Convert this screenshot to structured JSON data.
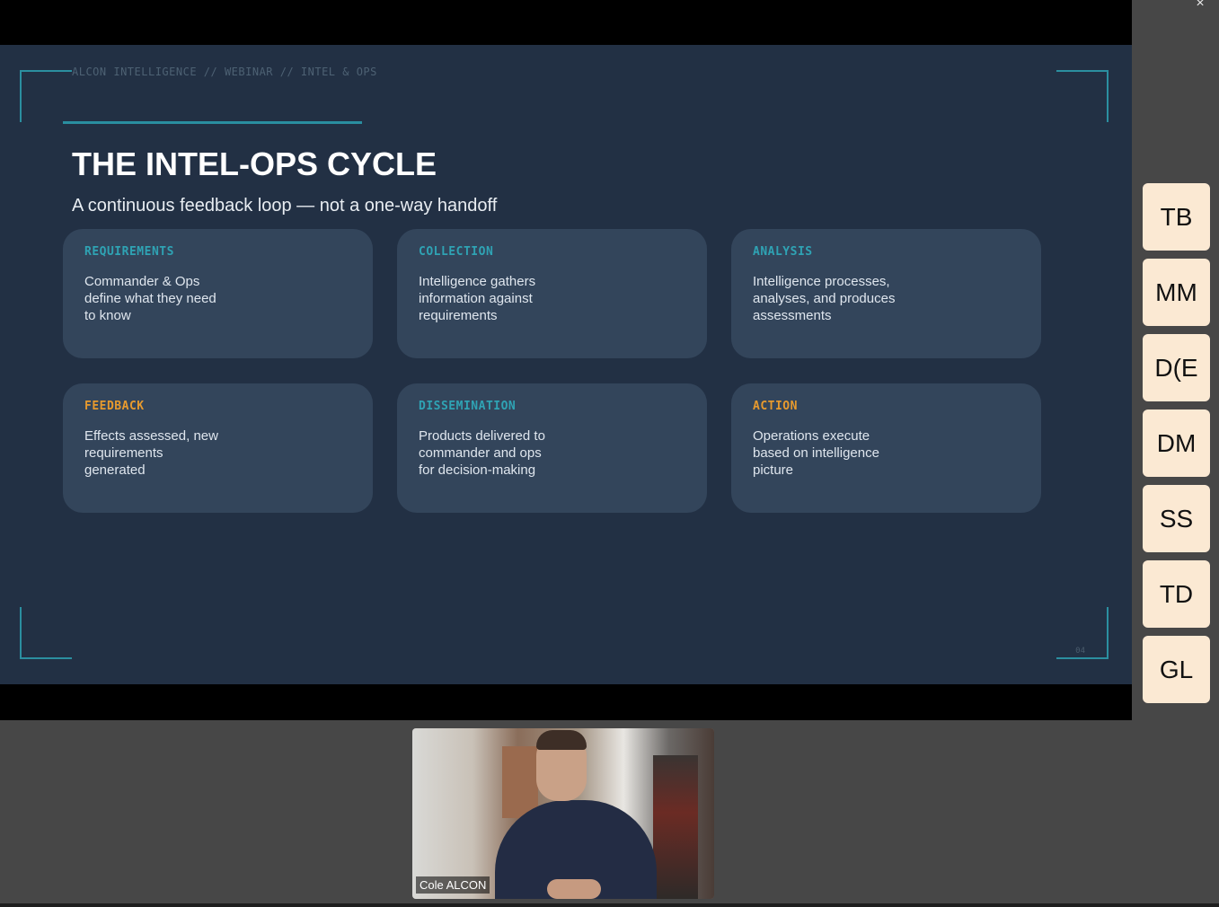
{
  "window": {
    "close_glyph": "×"
  },
  "slide": {
    "breadcrumb": "ALCON INTELLIGENCE // WEBINAR // INTEL & OPS",
    "title": "THE INTEL-OPS CYCLE",
    "subtitle": "A continuous feedback loop — not a one-way handoff",
    "page_number": "04",
    "colors": {
      "teal": "#2fa3b4",
      "orange": "#e79a2e",
      "card": "#33455b",
      "background": "#223044"
    },
    "cards": [
      {
        "label": "REQUIREMENTS",
        "text": "Commander & Ops define what they need to know",
        "color": "#2fa3b4"
      },
      {
        "label": "COLLECTION",
        "text": "Intelligence gathers information against requirements",
        "color": "#2fa3b4"
      },
      {
        "label": "ANALYSIS",
        "text": "Intelligence processes, analyses, and produces assessments",
        "color": "#2fa3b4"
      },
      {
        "label": "FEEDBACK",
        "text": "Effects assessed, new requirements generated",
        "color": "#e79a2e"
      },
      {
        "label": "DISSEMINATION",
        "text": "Products delivered to commander and ops for decision-making",
        "color": "#2fa3b4"
      },
      {
        "label": "ACTION",
        "text": "Operations execute based on intelligence picture",
        "color": "#e79a2e"
      }
    ]
  },
  "participants": [
    {
      "initials": "TB"
    },
    {
      "initials": "MM"
    },
    {
      "initials": "D(E"
    },
    {
      "initials": "DM"
    },
    {
      "initials": "SS"
    },
    {
      "initials": "TD"
    },
    {
      "initials": "GL"
    }
  ],
  "video": {
    "name": "Cole ALCON"
  }
}
